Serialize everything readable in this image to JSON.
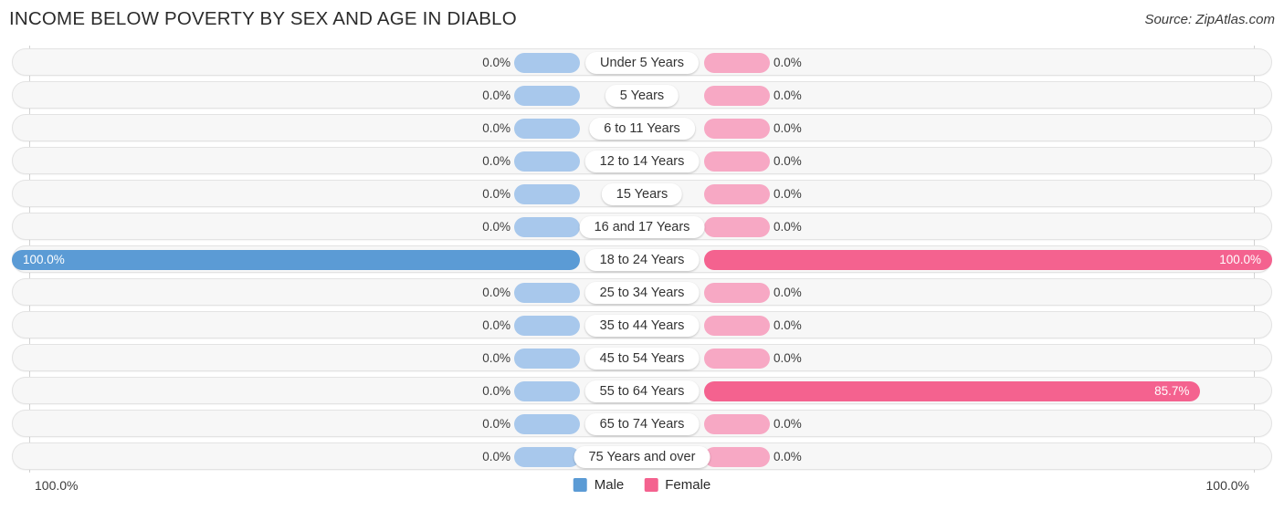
{
  "header": {
    "title": "INCOME BELOW POVERTY BY SEX AND AGE IN DIABLO",
    "source": "Source: ZipAtlas.com"
  },
  "legend": {
    "male_label": "Male",
    "female_label": "Female",
    "male_color": "#5b9bd5",
    "female_color": "#f4628f",
    "male_zero_color": "#a8c8ec",
    "female_zero_color": "#f7a8c4"
  },
  "axis": {
    "left_end_label": "100.0%",
    "right_end_label": "100.0%",
    "max": 100.0
  },
  "chart_data": {
    "type": "bar",
    "title": "INCOME BELOW POVERTY BY SEX AND AGE IN DIABLO",
    "xlabel": "",
    "ylabel": "",
    "orientation": "horizontal-diverging",
    "xlim": [
      0,
      100
    ],
    "grid": false,
    "legend_position": "bottom-center",
    "categories": [
      "Under 5 Years",
      "5 Years",
      "6 to 11 Years",
      "12 to 14 Years",
      "15 Years",
      "16 and 17 Years",
      "18 to 24 Years",
      "25 to 34 Years",
      "35 to 44 Years",
      "45 to 54 Years",
      "55 to 64 Years",
      "65 to 74 Years",
      "75 Years and over"
    ],
    "series": [
      {
        "name": "Male",
        "values": [
          0.0,
          0.0,
          0.0,
          0.0,
          0.0,
          0.0,
          100.0,
          0.0,
          0.0,
          0.0,
          0.0,
          0.0,
          0.0
        ]
      },
      {
        "name": "Female",
        "values": [
          0.0,
          0.0,
          0.0,
          0.0,
          0.0,
          0.0,
          100.0,
          0.0,
          0.0,
          0.0,
          85.7,
          0.0,
          0.0
        ]
      }
    ]
  },
  "rows": [
    {
      "label": "Under 5 Years",
      "male": "0.0%",
      "female": "0.0%",
      "male_pct": 0.0,
      "female_pct": 0.0
    },
    {
      "label": "5 Years",
      "male": "0.0%",
      "female": "0.0%",
      "male_pct": 0.0,
      "female_pct": 0.0
    },
    {
      "label": "6 to 11 Years",
      "male": "0.0%",
      "female": "0.0%",
      "male_pct": 0.0,
      "female_pct": 0.0
    },
    {
      "label": "12 to 14 Years",
      "male": "0.0%",
      "female": "0.0%",
      "male_pct": 0.0,
      "female_pct": 0.0
    },
    {
      "label": "15 Years",
      "male": "0.0%",
      "female": "0.0%",
      "male_pct": 0.0,
      "female_pct": 0.0
    },
    {
      "label": "16 and 17 Years",
      "male": "0.0%",
      "female": "0.0%",
      "male_pct": 0.0,
      "female_pct": 0.0
    },
    {
      "label": "18 to 24 Years",
      "male": "100.0%",
      "female": "100.0%",
      "male_pct": 100.0,
      "female_pct": 100.0
    },
    {
      "label": "25 to 34 Years",
      "male": "0.0%",
      "female": "0.0%",
      "male_pct": 0.0,
      "female_pct": 0.0
    },
    {
      "label": "35 to 44 Years",
      "male": "0.0%",
      "female": "0.0%",
      "male_pct": 0.0,
      "female_pct": 0.0
    },
    {
      "label": "45 to 54 Years",
      "male": "0.0%",
      "female": "0.0%",
      "male_pct": 0.0,
      "female_pct": 0.0
    },
    {
      "label": "55 to 64 Years",
      "male": "0.0%",
      "female": "85.7%",
      "male_pct": 0.0,
      "female_pct": 85.7
    },
    {
      "label": "65 to 74 Years",
      "male": "0.0%",
      "female": "0.0%",
      "male_pct": 0.0,
      "female_pct": 0.0
    },
    {
      "label": "75 Years and over",
      "male": "0.0%",
      "female": "0.0%",
      "male_pct": 0.0,
      "female_pct": 0.0
    }
  ]
}
